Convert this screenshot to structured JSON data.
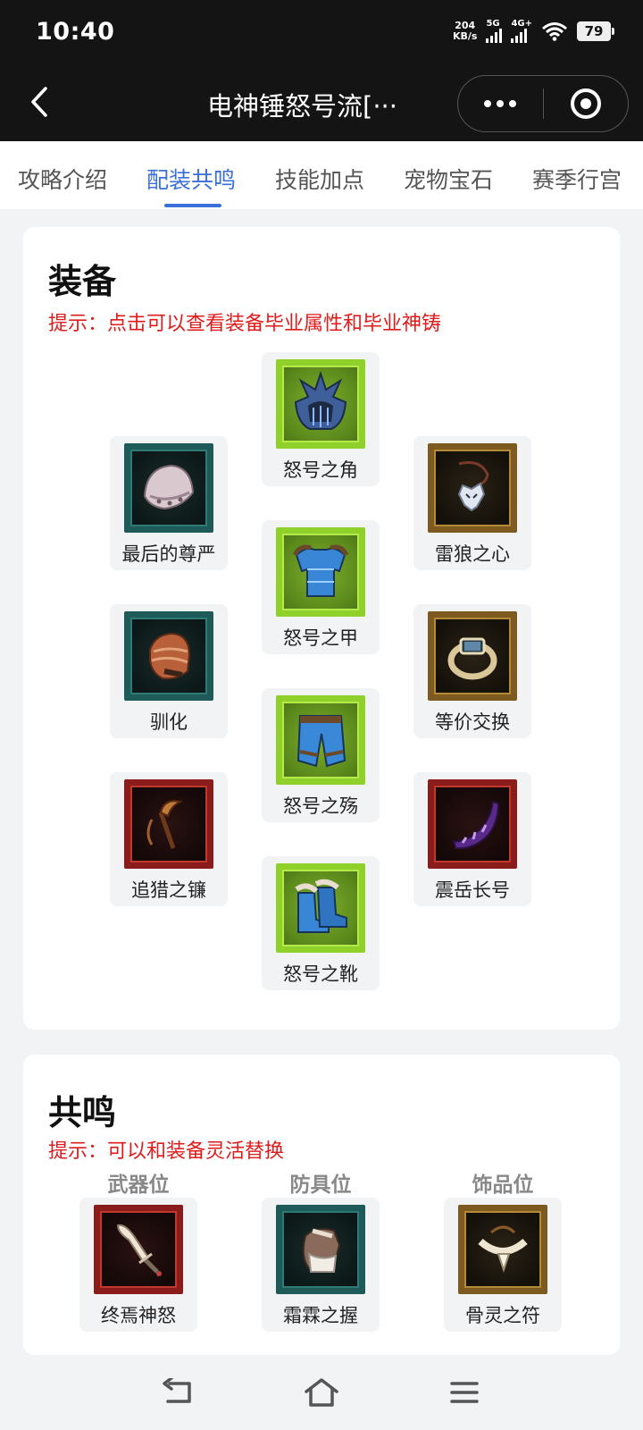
{
  "status_bar": {
    "time": "10:40",
    "net_speed_value": "204",
    "net_speed_unit": "KB/s",
    "signal1_label": "5G",
    "signal2_label": "4G+",
    "battery": "79"
  },
  "title_bar": {
    "title": "电神锤怒号流[···",
    "back_icon": "chevron-left-icon",
    "more_icon": "more-dots-icon",
    "close_icon": "target-icon"
  },
  "tabs": [
    {
      "label": "攻略介绍"
    },
    {
      "label": "配装共鸣",
      "active": true
    },
    {
      "label": "技能加点"
    },
    {
      "label": "宠物宝石"
    },
    {
      "label": "赛季行宫"
    }
  ],
  "equipment": {
    "title": "装备",
    "hint": "提示：点击可以查看装备毕业属性和毕业神铸",
    "items": [
      {
        "name": "怒号之角",
        "rarity": "green",
        "icon": "helmet-icon"
      },
      {
        "name": "最后的尊严",
        "rarity": "teal",
        "icon": "shoulder-icon"
      },
      {
        "name": "雷狼之心",
        "rarity": "gold",
        "icon": "amulet-icon"
      },
      {
        "name": "怒号之甲",
        "rarity": "green",
        "icon": "chest-armor-icon"
      },
      {
        "name": "驯化",
        "rarity": "teal",
        "icon": "gauntlet-icon"
      },
      {
        "name": "等价交换",
        "rarity": "gold",
        "icon": "ring-icon"
      },
      {
        "name": "怒号之殇",
        "rarity": "green",
        "icon": "pants-icon"
      },
      {
        "name": "追猎之镰",
        "rarity": "red",
        "icon": "scythe-icon"
      },
      {
        "name": "震岳长号",
        "rarity": "red",
        "icon": "horn-icon"
      },
      {
        "name": "怒号之靴",
        "rarity": "green",
        "icon": "boots-icon"
      }
    ]
  },
  "resonance": {
    "title": "共鸣",
    "hint": "提示：可以和装备灵活替换",
    "slots": [
      {
        "slot": "武器位",
        "name": "终焉神怒",
        "rarity": "red",
        "icon": "bone-blade-icon"
      },
      {
        "slot": "防具位",
        "name": "霜霖之握",
        "rarity": "teal",
        "icon": "fur-gauntlet-icon"
      },
      {
        "slot": "饰品位",
        "name": "骨灵之符",
        "rarity": "gold",
        "icon": "fang-necklace-icon"
      }
    ]
  },
  "bottom_nav": {
    "back_icon": "return-icon",
    "home_icon": "home-icon",
    "menu_icon": "menu-icon"
  }
}
